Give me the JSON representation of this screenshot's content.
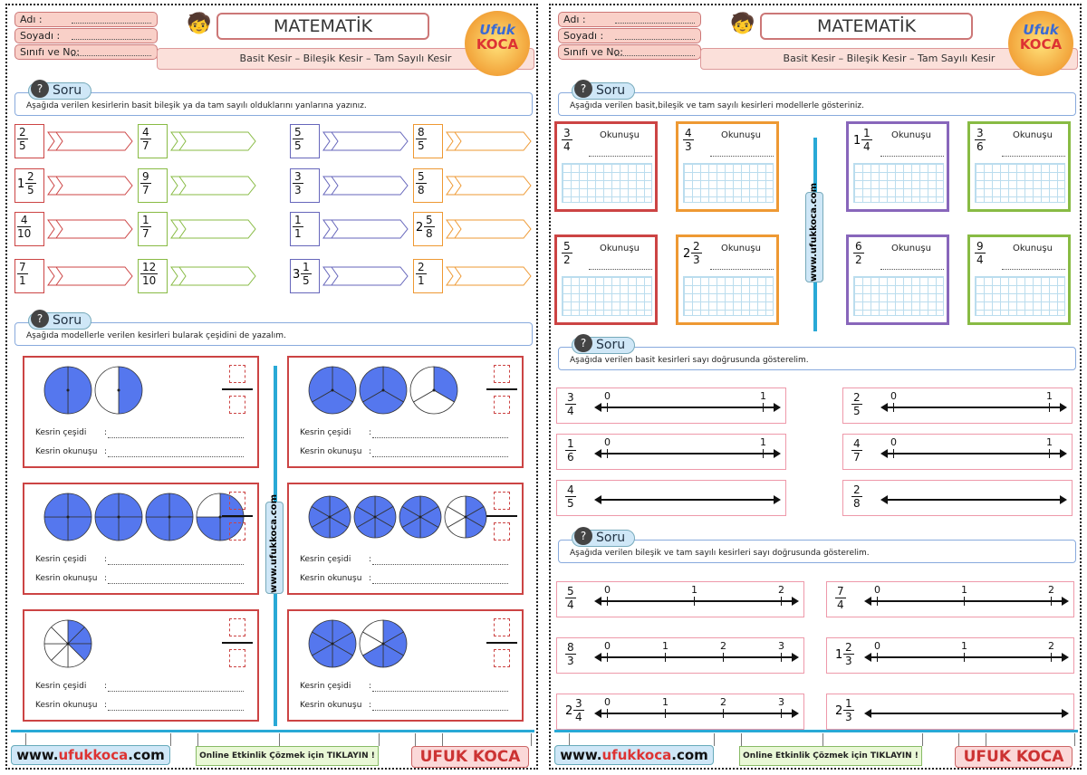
{
  "header": {
    "labels": [
      "Adı :",
      "Soyadı :",
      "Sınıfı ve No:"
    ],
    "title": "MATEMATİK",
    "subtitle": "Basit Kesir – Bileşik Kesir – Tam Sayılı Kesir",
    "logo_top": "Ufuk",
    "logo_bottom": "KOCA"
  },
  "soru_label": "Soru",
  "p1": {
    "q1": "Aşağıda verilen kesirlerin basit bileşik ya da tam sayılı olduklarını yanlarına yazınız.",
    "q1_items": [
      {
        "w": "",
        "n": "2",
        "d": "5",
        "c": "#c44"
      },
      {
        "w": "",
        "n": "4",
        "d": "7",
        "c": "#8b4"
      },
      {
        "w": "",
        "n": "5",
        "d": "5",
        "c": "#66b"
      },
      {
        "w": "",
        "n": "8",
        "d": "5",
        "c": "#e93"
      },
      {
        "w": "1",
        "n": "2",
        "d": "5",
        "c": "#c44"
      },
      {
        "w": "",
        "n": "9",
        "d": "7",
        "c": "#8b4"
      },
      {
        "w": "",
        "n": "3",
        "d": "3",
        "c": "#66b"
      },
      {
        "w": "",
        "n": "5",
        "d": "8",
        "c": "#e93"
      },
      {
        "w": "",
        "n": "4",
        "d": "10",
        "c": "#c44"
      },
      {
        "w": "",
        "n": "1",
        "d": "7",
        "c": "#8b4"
      },
      {
        "w": "",
        "n": "1",
        "d": "1",
        "c": "#66b"
      },
      {
        "w": "2",
        "n": "5",
        "d": "8",
        "c": "#e93"
      },
      {
        "w": "",
        "n": "7",
        "d": "1",
        "c": "#c44"
      },
      {
        "w": "",
        "n": "12",
        "d": "10",
        "c": "#8b4"
      },
      {
        "w": "3",
        "n": "1",
        "d": "5",
        "c": "#66b"
      },
      {
        "w": "",
        "n": "2",
        "d": "1",
        "c": "#e93"
      }
    ],
    "q2": "Aşağıda modellerle verilen kesirleri bularak çeşidini de yazalım.",
    "kesrin_cesidi": "Kesrin çeşidi",
    "kesrin_okunusu": "Kesrin okunuşu",
    "models": [
      {
        "parts": 2,
        "full": 1,
        "partial": 1
      },
      {
        "parts": 3,
        "full": 2,
        "partial": 1
      },
      {
        "parts": 4,
        "full": 3,
        "partial": 3
      },
      {
        "parts": 6,
        "full": 3,
        "partial": 3
      },
      {
        "parts": 8,
        "full": 0,
        "partial": 3
      },
      {
        "parts": 6,
        "full": 1,
        "partial": 4
      }
    ]
  },
  "p2": {
    "q1": "Aşağıda verilen basit,bileşik ve tam sayılı kesirleri modellerle gösteriniz.",
    "okunusu": "Okunuşu",
    "boxes": [
      {
        "w": "",
        "n": "3",
        "d": "4",
        "c": "#c44"
      },
      {
        "w": "",
        "n": "4",
        "d": "3",
        "c": "#e93"
      },
      {
        "w": "1",
        "n": "1",
        "d": "4",
        "c": "#86b"
      },
      {
        "w": "",
        "n": "3",
        "d": "6",
        "c": "#8b4"
      },
      {
        "w": "",
        "n": "5",
        "d": "2",
        "c": "#c44"
      },
      {
        "w": "2",
        "n": "2",
        "d": "3",
        "c": "#e93"
      },
      {
        "w": "",
        "n": "6",
        "d": "2",
        "c": "#86b"
      },
      {
        "w": "",
        "n": "9",
        "d": "4",
        "c": "#8b4"
      }
    ],
    "q2": "Aşağıda verilen basit kesirleri sayı doğrusunda gösterelim.",
    "nl1": [
      {
        "w": "",
        "n": "3",
        "d": "4",
        "ticks": [
          "0",
          "1"
        ]
      },
      {
        "w": "",
        "n": "2",
        "d": "5",
        "ticks": [
          "0",
          "1"
        ]
      },
      {
        "w": "",
        "n": "1",
        "d": "6",
        "ticks": [
          "0",
          "1"
        ]
      },
      {
        "w": "",
        "n": "4",
        "d": "7",
        "ticks": [
          "0",
          "1"
        ]
      },
      {
        "w": "",
        "n": "4",
        "d": "5",
        "ticks": []
      },
      {
        "w": "",
        "n": "2",
        "d": "8",
        "ticks": []
      }
    ],
    "q3": "Aşağıda verilen bileşik ve tam sayılı kesirleri sayı doğrusunda gösterelim.",
    "nl2": [
      {
        "w": "",
        "n": "5",
        "d": "4",
        "ticks": [
          "0",
          "1",
          "2"
        ]
      },
      {
        "w": "",
        "n": "7",
        "d": "4",
        "ticks": [
          "0",
          "1",
          "2"
        ]
      },
      {
        "w": "",
        "n": "8",
        "d": "3",
        "ticks": [
          "0",
          "1",
          "2",
          "3"
        ]
      },
      {
        "w": "1",
        "n": "2",
        "d": "3",
        "ticks": [
          "0",
          "1",
          "2"
        ]
      },
      {
        "w": "2",
        "n": "3",
        "d": "4",
        "ticks": [
          "0",
          "1",
          "2",
          "3"
        ]
      },
      {
        "w": "2",
        "n": "1",
        "d": "3",
        "ticks": []
      }
    ]
  },
  "footer": {
    "url_a": "www.",
    "url_b": "ufukkoca",
    "url_c": ".com",
    "online": "Online Etkinlik Çözmek için TIKLAYIN !",
    "brand": "UFUK KOCA",
    "vtag": "www.ufukkoca.com"
  }
}
